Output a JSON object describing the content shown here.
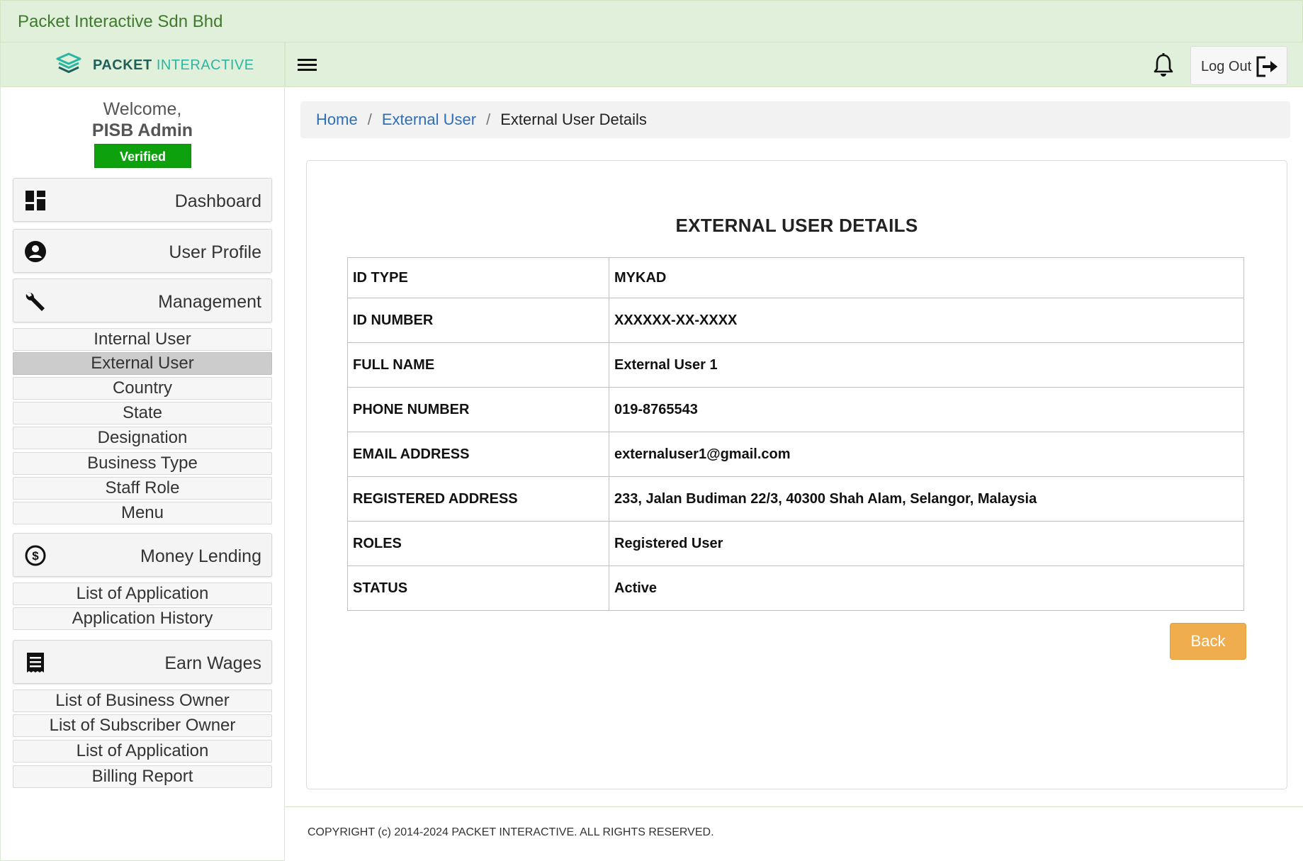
{
  "app": {
    "title": "Packet Interactive Sdn Bhd"
  },
  "brand": {
    "name_bold": "PACKET",
    "name_light": "INTERACTIVE"
  },
  "user": {
    "welcome": "Welcome,",
    "name": "PISB Admin",
    "badge": "Verified"
  },
  "header": {
    "logout_label": "Log Out"
  },
  "nav": {
    "dashboard": "Dashboard",
    "user_profile": "User Profile",
    "management": "Management",
    "management_items": [
      "Internal User",
      "External User",
      "Country",
      "State",
      "Designation",
      "Business Type",
      "Staff Role",
      "Menu"
    ],
    "money_lending": "Money Lending",
    "money_lending_items": [
      "List of Application",
      "Application History"
    ],
    "earn_wages": "Earn Wages",
    "earn_wages_items": [
      "List of Business Owner",
      "List of Subscriber Owner",
      "List of Application",
      "Billing Report"
    ],
    "active_item": "External User"
  },
  "breadcrumb": {
    "home": "Home",
    "section": "External User",
    "current": "External User Details",
    "separator": "/"
  },
  "details": {
    "title": "EXTERNAL USER DETAILS",
    "rows": [
      {
        "label": "ID TYPE",
        "value": "MYKAD"
      },
      {
        "label": "ID NUMBER",
        "value": "XXXXXX-XX-XXXX"
      },
      {
        "label": "FULL NAME",
        "value": "External User 1"
      },
      {
        "label": "PHONE NUMBER",
        "value": "019-8765543"
      },
      {
        "label": "EMAIL ADDRESS",
        "value": "externaluser1@gmail.com"
      },
      {
        "label": "REGISTERED ADDRESS",
        "value": "233, Jalan Budiman 22/3, 40300 Shah Alam, Selangor, Malaysia"
      },
      {
        "label": "ROLES",
        "value": "Registered User"
      },
      {
        "label": "STATUS",
        "value": "Active"
      }
    ],
    "back_label": "Back"
  },
  "footer": {
    "copyright": "COPYRIGHT (c) 2014-2024 PACKET INTERACTIVE. ALL RIGHTS RESERVED."
  },
  "colors": {
    "header_green": "#e1f0da",
    "badge_green": "#0ea10e",
    "link_blue": "#2f6fb7",
    "back_orange": "#f0ad4e"
  }
}
